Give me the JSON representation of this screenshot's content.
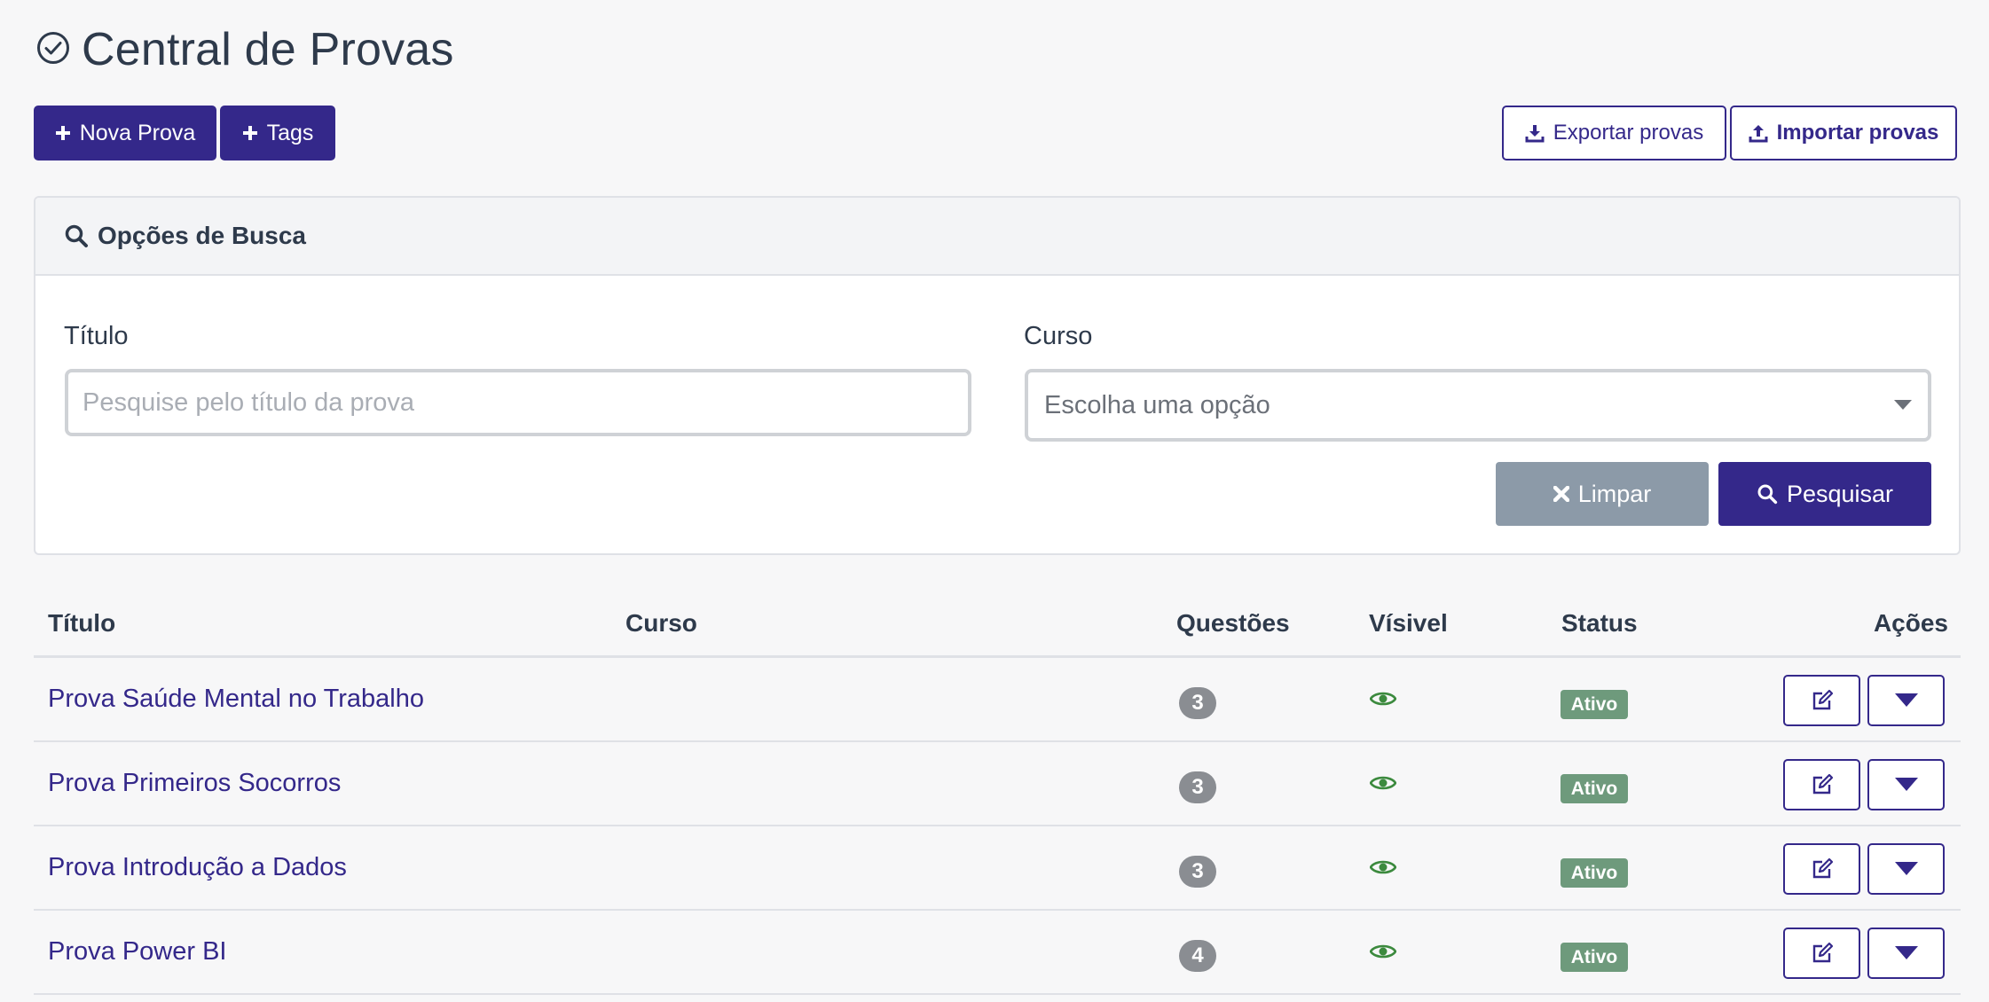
{
  "header": {
    "title": "Central de Provas",
    "icon": "check-circle-icon"
  },
  "toolbar": {
    "new_exam_label": "Nova Prova",
    "tags_label": "Tags",
    "export_label": "Exportar provas",
    "import_label": "Importar provas"
  },
  "search": {
    "header_title": "Opções de Busca",
    "title_label": "Título",
    "title_placeholder": "Pesquise pelo título da prova",
    "title_value": "",
    "course_label": "Curso",
    "course_value": "Escolha uma opção",
    "clear_label": "Limpar",
    "search_label": "Pesquisar"
  },
  "table": {
    "columns": [
      "Título",
      "Curso",
      "Questões",
      "Vísivel",
      "Status",
      "Ações"
    ],
    "rows": [
      {
        "title": "Prova Saúde Mental no Trabalho",
        "course": "",
        "questions": "3",
        "visible": true,
        "status": "Ativo"
      },
      {
        "title": "Prova Primeiros Socorros",
        "course": "",
        "questions": "3",
        "visible": true,
        "status": "Ativo"
      },
      {
        "title": "Prova Introdução a Dados",
        "course": "",
        "questions": "3",
        "visible": true,
        "status": "Ativo"
      },
      {
        "title": "Prova Power BI",
        "course": "",
        "questions": "4",
        "visible": true,
        "status": "Ativo"
      }
    ]
  },
  "colors": {
    "primary": "#34288a",
    "clear_button": "#8c9aa8",
    "status_active": "#6e9a7c",
    "visible_icon": "#3c8a3e",
    "count_badge": "#8a8d92"
  }
}
